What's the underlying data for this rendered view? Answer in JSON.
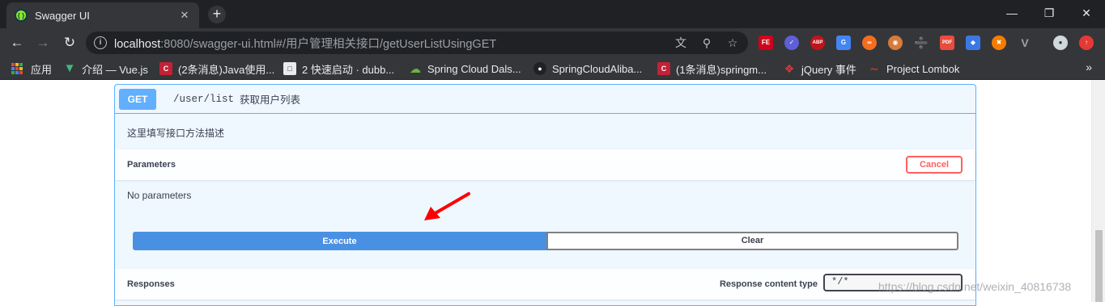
{
  "browser": {
    "tab_title": "Swagger UI",
    "tab_close": "✕",
    "new_tab": "+",
    "url_host": "localhost",
    "url_rest": ":8080/swagger-ui.html#/用户管理相关接口/getUserListUsingGET",
    "bookmarks": [
      {
        "label": "应用",
        "icon": "apps-icon"
      },
      {
        "label": "介绍 — Vue.js",
        "icon": "vue-icon",
        "color": "#41b883"
      },
      {
        "label": "(2条消息)Java使用...",
        "icon": "csdn-icon",
        "color": "#c32136"
      },
      {
        "label": "2 快速启动 · dubb...",
        "icon": "book-icon",
        "color": "#e8eaed"
      },
      {
        "label": "Spring Cloud Dals...",
        "icon": "spring-cloud-icon",
        "color": "#6db33f"
      },
      {
        "label": "SpringCloudAliba...",
        "icon": "github-icon",
        "color": "#202124"
      },
      {
        "label": "(1条消息)springm...",
        "icon": "csdn-icon",
        "color": "#c32136"
      },
      {
        "label": "jQuery 事件",
        "icon": "jquery-icon",
        "color": "#d63b3b"
      },
      {
        "label": "Project Lombok",
        "icon": "lombok-icon",
        "color": "#c0392b"
      }
    ]
  },
  "operation": {
    "method": "GET",
    "path": "/user/list",
    "summary": "获取用户列表",
    "description": "这里填写接口方法描述",
    "parameters_title": "Parameters",
    "cancel_label": "Cancel",
    "no_parameters": "No parameters",
    "execute_label": "Execute",
    "clear_label": "Clear",
    "responses_title": "Responses",
    "response_content_type_label": "Response content type",
    "response_content_type_value": "*/*"
  },
  "watermark": "https://blog.csdn.net/weixin_40816738",
  "colors": {
    "get_method": "#61affe",
    "execute": "#4990e2",
    "cancel": "#ff6060"
  }
}
